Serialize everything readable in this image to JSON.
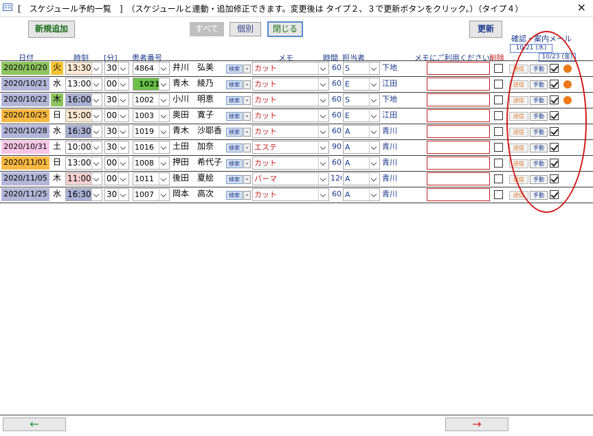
{
  "window": {
    "title": "[　スケジュール予約一覧　]　（スケジュールと連動・追加修正できます。変更後は タイプ２、３で更新ボタンをクリック。）（タイプ４）",
    "close_label": "×"
  },
  "toolbar": {
    "new_label": "新規追加",
    "all_label": "すべて",
    "individual_label": "個別",
    "close_label": "閉じる",
    "update_label": "更新"
  },
  "mail_header": {
    "title": "確認・案内メール",
    "date1": "10/21 (水)",
    "date2": "10/23 (金)"
  },
  "columns": {
    "date": "日付",
    "time": "時刻",
    "minutes": "[分]",
    "patient_no": "患者番号",
    "memo": "メモ",
    "duration": "時間",
    "staff": "担当者",
    "note": "メモにご利用ください。",
    "delete": "削除"
  },
  "buttons": {
    "search": "検索",
    "dot": "・",
    "send": "送信",
    "manual": "手動"
  },
  "colors": {
    "accent_red": "#d01818",
    "header_blue": "#1a3a8c",
    "dot_orange": "#ec7a1a"
  },
  "rows": [
    {
      "date": "2020/10/20",
      "date_bg": "#8ec460",
      "dow": "火",
      "dow_bg": "#f2c232",
      "time": "13:30",
      "time_bg": "#fde9d2",
      "min": "30",
      "pid": "4864",
      "pid_bg": "#fff",
      "pid_bold": false,
      "name": "井川　弘美",
      "memo": "カット",
      "dur": "60",
      "staff": "S",
      "staffname": "下地",
      "del": false,
      "mail": true,
      "dot": true
    },
    {
      "date": "2020/10/21",
      "date_bg": "#b3b6d8",
      "dow": "水",
      "dow_bg": "#fff",
      "time": "13:00",
      "time_bg": "#fff",
      "min": "00",
      "pid": "1021",
      "pid_bg": "#6fbf4a",
      "pid_bold": true,
      "name": "青木　綾乃",
      "memo": "カット",
      "dur": "60",
      "staff": "E",
      "staffname": "江田",
      "del": false,
      "mail": true,
      "dot": true
    },
    {
      "date": "2020/10/22",
      "date_bg": "#b3b6d8",
      "dow": "木",
      "dow_bg": "#8ec460",
      "time": "16:00",
      "time_bg": "#aab0d4",
      "min": "30",
      "pid": "1002",
      "pid_bg": "#fff",
      "pid_bold": false,
      "name": "小川　明恵",
      "memo": "カット",
      "dur": "60",
      "staff": "S",
      "staffname": "下地",
      "del": false,
      "mail": true,
      "dot": true
    },
    {
      "date": "2020/10/25",
      "date_bg": "#f7b942",
      "dow": "日",
      "dow_bg": "#fff",
      "time": "15:00",
      "time_bg": "#fde9d2",
      "min": "00",
      "pid": "1003",
      "pid_bg": "#fff",
      "pid_bold": false,
      "name": "奥田　寛子",
      "memo": "カット",
      "dur": "60",
      "staff": "E",
      "staffname": "江田",
      "del": false,
      "mail": true,
      "dot": false
    },
    {
      "date": "2020/10/28",
      "date_bg": "#b3b6d8",
      "dow": "水",
      "dow_bg": "#fff",
      "time": "16:30",
      "time_bg": "#aab0d4",
      "min": "30",
      "pid": "1019",
      "pid_bg": "#fff",
      "pid_bold": false,
      "name": "青木　沙耶香",
      "memo": "カット",
      "dur": "60",
      "staff": "A",
      "staffname": "青川",
      "del": false,
      "mail": true,
      "dot": false
    },
    {
      "date": "2020/10/31",
      "date_bg": "#f7c6e6",
      "dow": "土",
      "dow_bg": "#fff",
      "time": "10:00",
      "time_bg": "#fff",
      "min": "30",
      "pid": "1016",
      "pid_bg": "#fff",
      "pid_bold": false,
      "name": "土田　加奈",
      "memo": "エステ",
      "dur": "90",
      "staff": "A",
      "staffname": "青川",
      "del": false,
      "mail": true,
      "dot": false
    },
    {
      "date": "2020/11/01",
      "date_bg": "#f7b942",
      "dow": "日",
      "dow_bg": "#fff",
      "time": "13:00",
      "time_bg": "#fff",
      "min": "00",
      "pid": "1008",
      "pid_bg": "#fff",
      "pid_bold": false,
      "name": "押田　希代子",
      "memo": "カット",
      "dur": "60",
      "staff": "A",
      "staffname": "青川",
      "del": false,
      "mail": true,
      "dot": false
    },
    {
      "date": "2020/11/05",
      "date_bg": "#b3b6d8",
      "dow": "木",
      "dow_bg": "#fff",
      "time": "11:00",
      "time_bg": "#f5d0d0",
      "min": "00",
      "pid": "1011",
      "pid_bg": "#fff",
      "pid_bold": false,
      "name": "後田　夏絵",
      "memo": "パーマ",
      "dur": "120",
      "staff": "A",
      "staffname": "青川",
      "del": false,
      "mail": true,
      "dot": false
    },
    {
      "date": "2020/11/25",
      "date_bg": "#b3b6d8",
      "dow": "水",
      "dow_bg": "#fff",
      "time": "16:30",
      "time_bg": "#aab0d4",
      "min": "30",
      "pid": "1007",
      "pid_bg": "#fff",
      "pid_bold": false,
      "name": "岡本　高次",
      "memo": "カット",
      "dur": "60",
      "staff": "A",
      "staffname": "青川",
      "del": false,
      "mail": true,
      "dot": false
    }
  ],
  "footer": {
    "prev_label": "←",
    "next_label": "→"
  }
}
